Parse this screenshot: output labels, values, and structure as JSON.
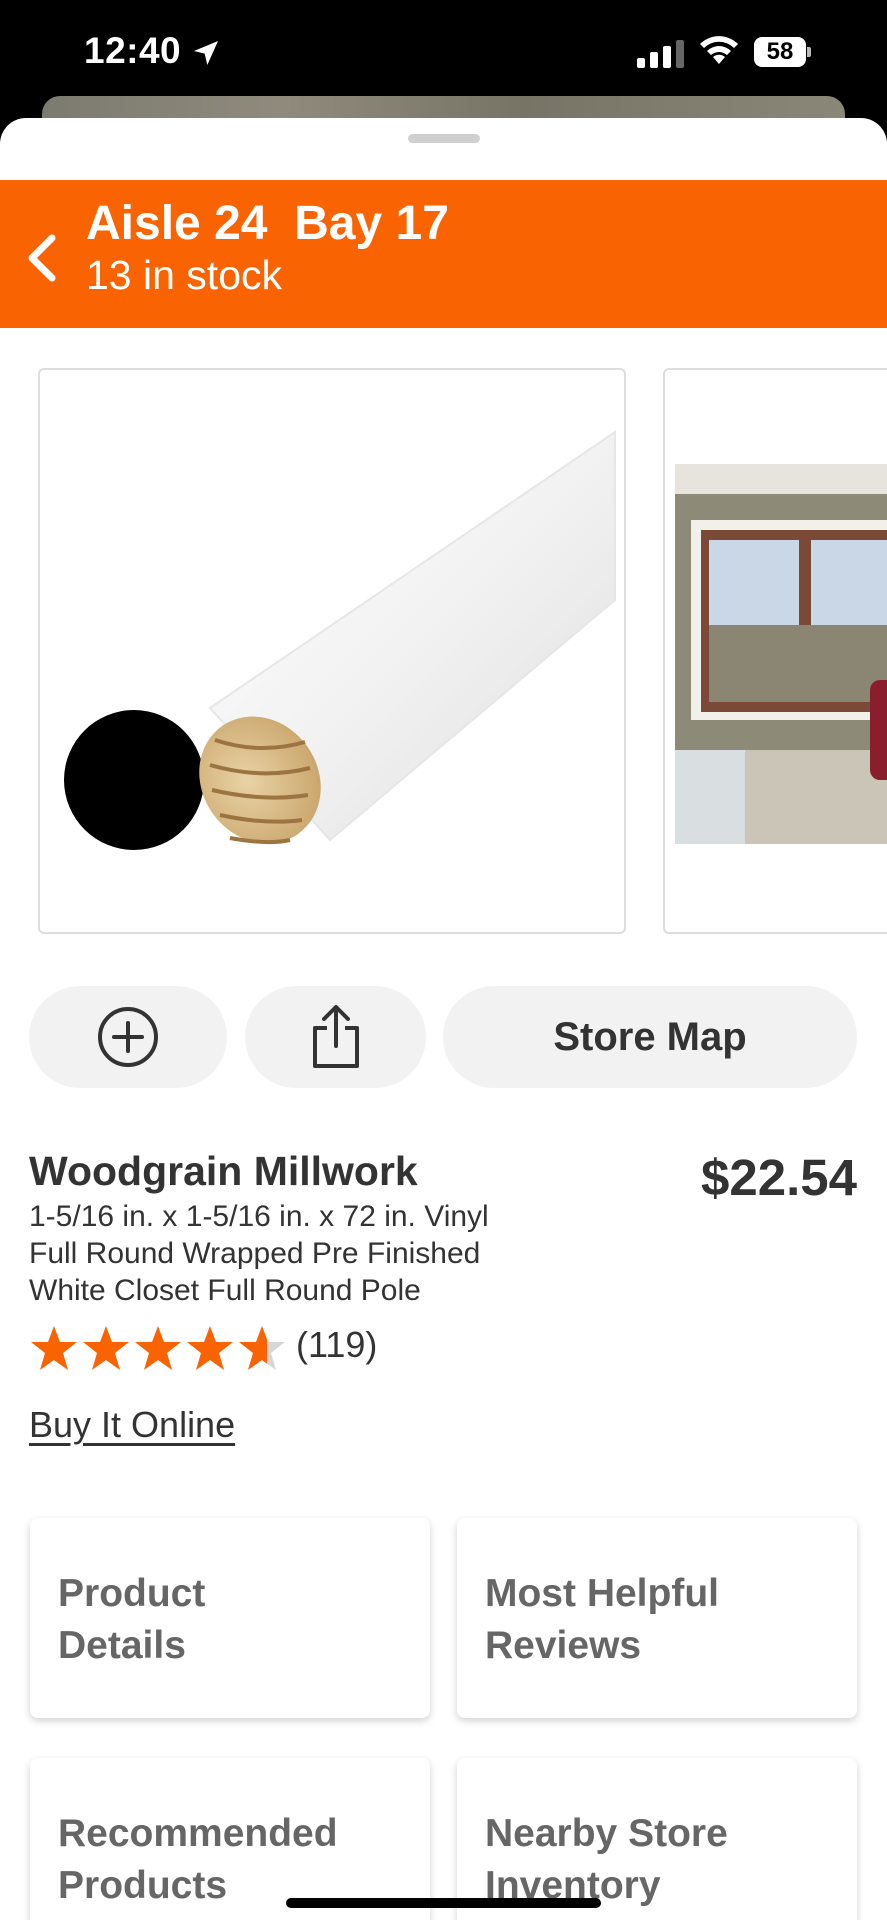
{
  "status_bar": {
    "time": "12:40",
    "battery": "58"
  },
  "header": {
    "aisle_title": "Aisle 24  Bay 17",
    "stock_text": "13 in stock"
  },
  "actions": {
    "store_map_label": "Store Map"
  },
  "product": {
    "brand": "Woodgrain Millwork",
    "price": "$22.54",
    "description_lines": [
      "1-5/16 in. x 1-5/16 in. x 72 in. Vinyl",
      "Full Round Wrapped Pre Finished",
      "White Closet Full Round Pole"
    ],
    "rating": 4.6,
    "rating_count": "(119)",
    "buy_online_label": "Buy It Online"
  },
  "tiles": [
    {
      "line1": "Product",
      "line2": "Details"
    },
    {
      "line1": "Most Helpful",
      "line2": "Reviews"
    },
    {
      "line1": "Recommended",
      "line2": "Products"
    },
    {
      "line1": "Nearby Store",
      "line2": "Inventory"
    }
  ],
  "colors": {
    "brand_orange": "#f96302",
    "star_orange": "#f96302"
  }
}
